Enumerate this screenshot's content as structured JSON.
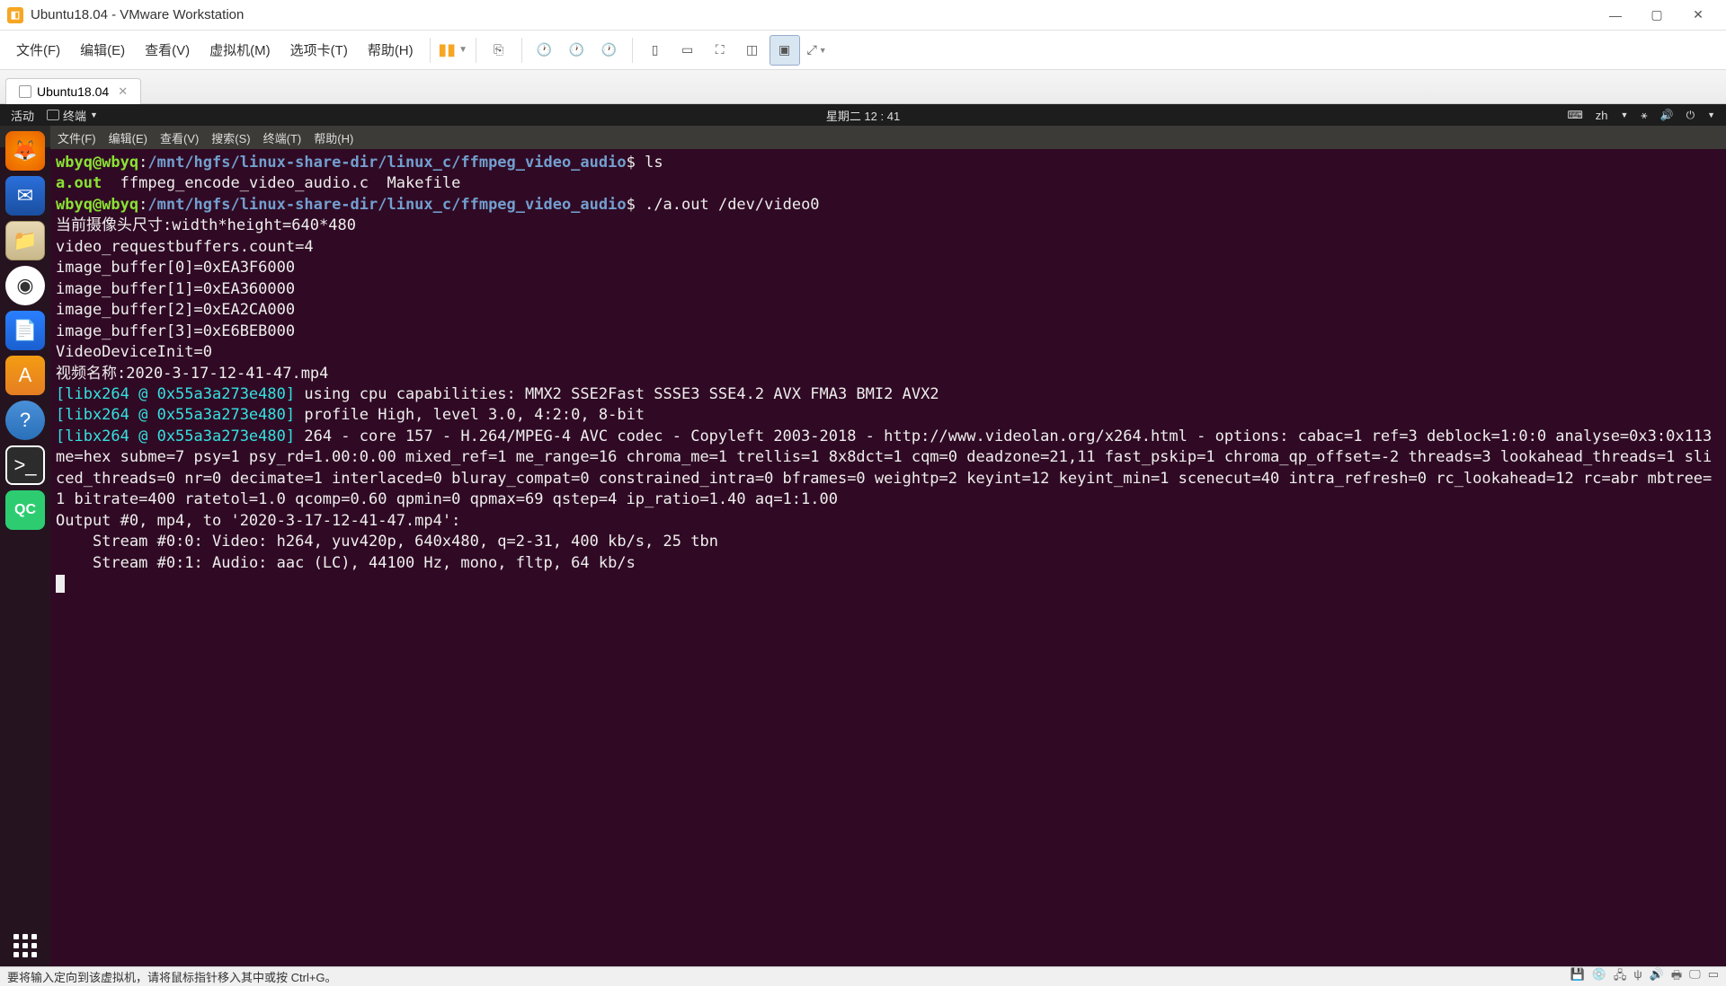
{
  "titlebar": {
    "title": "Ubuntu18.04 - VMware Workstation"
  },
  "menubar": {
    "items": [
      "文件(F)",
      "编辑(E)",
      "查看(V)",
      "虚拟机(M)",
      "选项卡(T)",
      "帮助(H)"
    ]
  },
  "tab": {
    "label": "Ubuntu18.04"
  },
  "gnome": {
    "activities": "活动",
    "terminal": "终端",
    "clock": "星期二 12 : 41",
    "lang": "zh"
  },
  "ubuntu_window_title": "wbyq@wbyq: /mnt/hgfs/linux-share-dir/linux_c/ffmpeg_video_audio",
  "term_menu": [
    "文件(F)",
    "编辑(E)",
    "查看(V)",
    "搜索(S)",
    "终端(T)",
    "帮助(H)"
  ],
  "prompt": {
    "user": "wbyq@wbyq",
    "path": "/mnt/hgfs/linux-share-dir/linux_c/ffmpeg_video_audio",
    "cmd1": "ls",
    "cmd2": "./a.out /dev/video0"
  },
  "ls_output": {
    "aout": "a.out",
    "src": "ffmpeg_encode_video_audio.c",
    "make": "Makefile"
  },
  "lines": {
    "l1": "当前摄像头尺寸:width*height=640*480",
    "l2": "video_requestbuffers.count=4",
    "l3": "image_buffer[0]=0xEA3F6000",
    "l4": "image_buffer[1]=0xEA360000",
    "l5": "image_buffer[2]=0xEA2CA000",
    "l6": "image_buffer[3]=0xE6BEB000",
    "l7": "VideoDeviceInit=0",
    "l8": "视频名称:2020-3-17-12-41-47.mp4"
  },
  "libx_tag": "[libx264 @ 0x55a3a273e480]",
  "libx": {
    "a": " using cpu capabilities: MMX2 SSE2Fast SSSE3 SSE4.2 AVX FMA3 BMI2 AVX2",
    "b": " profile High, level 3.0, 4:2:0, 8-bit",
    "c": " 264 - core 157 - H.264/MPEG-4 AVC codec - Copyleft 2003-2018 - http://www.videolan.org/x264.html - options: cabac=1 ref=3 deblock=1:0:0 analyse=0x3:0x113 me=hex subme=7 psy=1 psy_rd=1.00:0.00 mixed_ref=1 me_range=16 chroma_me=1 trellis=1 8x8dct=1 cqm=0 deadzone=21,11 fast_pskip=1 chroma_qp_offset=-2 threads=3 lookahead_threads=1 sliced_threads=0 nr=0 decimate=1 interlaced=0 bluray_compat=0 constrained_intra=0 bframes=0 weightp=2 keyint=12 keyint_min=1 scenecut=40 intra_refresh=0 rc_lookahead=12 rc=abr mbtree=1 bitrate=400 ratetol=1.0 qcomp=0.60 qpmin=0 qpmax=69 qstep=4 ip_ratio=1.40 aq=1:1.00"
  },
  "output": {
    "o1": "Output #0, mp4, to '2020-3-17-12-41-47.mp4':",
    "o2": "    Stream #0:0: Video: h264, yuv420p, 640x480, q=2-31, 400 kb/s, 25 tbn",
    "o3": "    Stream #0:1: Audio: aac (LC), 44100 Hz, mono, fltp, 64 kb/s"
  },
  "statusbar": {
    "hint": "要将输入定向到该虚拟机，请将鼠标指针移入其中或按 Ctrl+G。"
  }
}
